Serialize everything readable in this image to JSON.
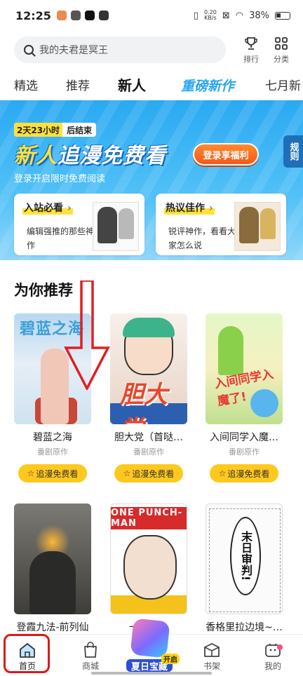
{
  "status_bar": {
    "time": "12:25",
    "net_speed_value": "0.20",
    "net_speed_unit": "KB/s",
    "battery": "38%"
  },
  "search": {
    "placeholder": "我的夫君是冥王"
  },
  "top_actions": [
    {
      "label": "排行",
      "icon": "trophy-icon"
    },
    {
      "label": "分类",
      "icon": "grid-icon"
    }
  ],
  "tabs": [
    {
      "label": "精选",
      "active": false
    },
    {
      "label": "推荐",
      "active": false
    },
    {
      "label": "新人",
      "active": true
    },
    {
      "label": "重磅新作",
      "active": false
    },
    {
      "label": "七月新",
      "active": false
    }
  ],
  "banner": {
    "countdown_time": "2天23小时",
    "countdown_suffix": "后结束",
    "title_highlight": "新人",
    "title_rest": "追漫免费看",
    "subtitle": "登录开启限时免费阅读",
    "login_button": "登录享福利",
    "rules_tab": "规则"
  },
  "promo_cards": [
    {
      "title": "入站必看",
      "desc": "编辑强推的那些神作"
    },
    {
      "title": "热议佳作",
      "desc": "锐评神作，看看大家怎么说"
    }
  ],
  "section": {
    "title": "为你推荐"
  },
  "comics": [
    {
      "title": "碧蓝之海",
      "subtitle": "番剧原作",
      "cover_text": "碧蓝之海",
      "button": "追漫免费看"
    },
    {
      "title": "胆大党（首哒…",
      "subtitle": "番剧原作",
      "cover_text": "胆大党",
      "button": "追漫免费看"
    },
    {
      "title": "入间同学入魔…",
      "subtitle": "番剧原作",
      "cover_text": "入间同学入魔了!",
      "button": "追漫免费看"
    },
    {
      "title": "登霞九法-前列仙",
      "subtitle": "",
      "cover_text": "",
      "button": ""
    },
    {
      "title": "一拳超人",
      "subtitle": "",
      "cover_text": "ONE PUNCH-MAN",
      "button": ""
    },
    {
      "title": "香格里拉边境~…",
      "subtitle": "",
      "cover_text": "末日审判!",
      "button": ""
    }
  ],
  "bottom_nav": [
    {
      "label": "首页",
      "icon": "home-icon",
      "active": true
    },
    {
      "label": "商城",
      "icon": "shopping-bag-icon",
      "active": false
    },
    {
      "label": "书架",
      "icon": "bookshelf-icon",
      "active": false
    },
    {
      "label": "我的",
      "icon": "profile-icon",
      "active": false
    }
  ],
  "treasure": {
    "label": "夏日宝藏",
    "tag": "开启"
  },
  "colors": {
    "accent_yellow": "#ffc81e",
    "banner_blue": "#2aa9f2",
    "login_orange": "#f5581a",
    "highlight_red": "#d81b1b"
  }
}
